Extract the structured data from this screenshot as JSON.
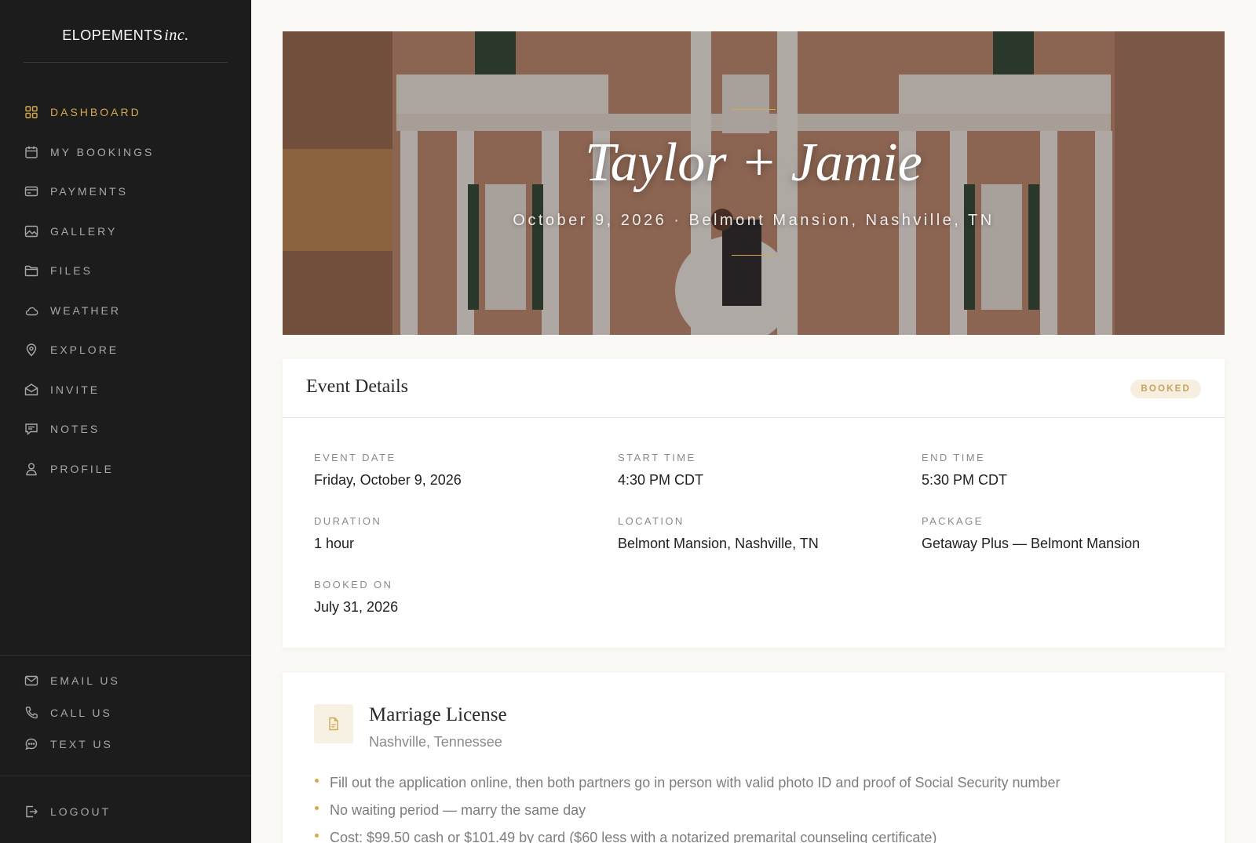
{
  "brand": {
    "name": "ELOPEMENTS",
    "script": "inc."
  },
  "nav": {
    "items": [
      {
        "label": "DASHBOARD",
        "icon": "grid-icon",
        "active": true
      },
      {
        "label": "MY BOOKINGS",
        "icon": "calendar-icon",
        "active": false
      },
      {
        "label": "PAYMENTS",
        "icon": "credit-card-icon",
        "active": false
      },
      {
        "label": "GALLERY",
        "icon": "image-icon",
        "active": false
      },
      {
        "label": "FILES",
        "icon": "folder-icon",
        "active": false
      },
      {
        "label": "WEATHER",
        "icon": "cloud-icon",
        "active": false
      },
      {
        "label": "EXPLORE",
        "icon": "map-pin-icon",
        "active": false
      },
      {
        "label": "INVITE",
        "icon": "envelope-open-icon",
        "active": false
      },
      {
        "label": "NOTES",
        "icon": "message-square-icon",
        "active": false
      },
      {
        "label": "PROFILE",
        "icon": "user-icon",
        "active": false
      }
    ]
  },
  "contacts": {
    "items": [
      {
        "label": "EMAIL US",
        "icon": "mail-icon"
      },
      {
        "label": "CALL US",
        "icon": "phone-icon"
      },
      {
        "label": "TEXT US",
        "icon": "chat-bubble-icon"
      }
    ]
  },
  "logout": {
    "label": "LOGOUT",
    "icon": "log-out-icon"
  },
  "hero": {
    "title": "Taylor + Jamie",
    "subtitle": "October 9, 2026 · Belmont Mansion, Nashville, TN"
  },
  "event_details": {
    "title": "Event Details",
    "status": "BOOKED",
    "fields": [
      {
        "label": "EVENT DATE",
        "value": "Friday, October 9, 2026"
      },
      {
        "label": "START TIME",
        "value": "4:30 PM CDT"
      },
      {
        "label": "END TIME",
        "value": "5:30 PM CDT"
      },
      {
        "label": "DURATION",
        "value": "1 hour"
      },
      {
        "label": "LOCATION",
        "value": "Belmont Mansion, Nashville, TN"
      },
      {
        "label": "PACKAGE",
        "value": "Getaway Plus — Belmont Mansion"
      },
      {
        "label": "BOOKED ON",
        "value": "July 31, 2026"
      }
    ]
  },
  "license": {
    "title": "Marriage License",
    "subtitle": "Nashville, Tennessee",
    "icon": "document-icon",
    "items": [
      "Fill out the application online, then both partners go in person with valid photo ID and proof of Social Security number",
      "No waiting period — marry the same day",
      "Cost: $99.50 cash or $101.49 by card ($60 less with a notarized premarital counseling certificate)"
    ]
  },
  "colors": {
    "sidebar_bg": "#1c1c1c",
    "accent": "#d4a94e",
    "page_bg": "#fbf9f5"
  }
}
